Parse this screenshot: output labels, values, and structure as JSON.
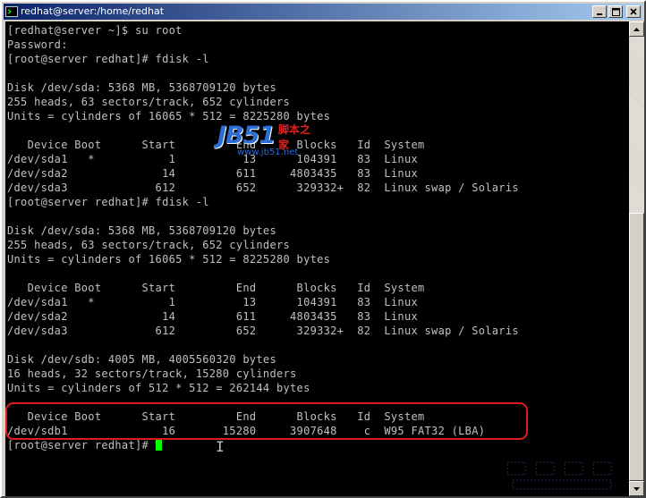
{
  "window": {
    "title": "redhat@server:/home/redhat",
    "controls": {
      "minimize": "_",
      "maximize": "□",
      "close": "×"
    }
  },
  "terminal": {
    "lines": [
      "[redhat@server ~]$ su root",
      "Password:",
      "[root@server redhat]# fdisk -l",
      "",
      "Disk /dev/sda: 5368 MB, 5368709120 bytes",
      "255 heads, 63 sectors/track, 652 cylinders",
      "Units = cylinders of 16065 * 512 = 8225280 bytes",
      "",
      "   Device Boot      Start         End      Blocks   Id  System",
      "/dev/sda1   *           1          13      104391   83  Linux",
      "/dev/sda2              14         611     4803435   83  Linux",
      "/dev/sda3             612         652      329332+  82  Linux swap / Solaris",
      "[root@server redhat]# fdisk -l",
      "",
      "Disk /dev/sda: 5368 MB, 5368709120 bytes",
      "255 heads, 63 sectors/track, 652 cylinders",
      "Units = cylinders of 16065 * 512 = 8225280 bytes",
      "",
      "   Device Boot      Start         End      Blocks   Id  System",
      "/dev/sda1   *           1          13      104391   83  Linux",
      "/dev/sda2              14         611     4803435   83  Linux",
      "/dev/sda3             612         652      329332+  82  Linux swap / Solaris",
      "",
      "Disk /dev/sdb: 4005 MB, 4005560320 bytes",
      "16 heads, 32 sectors/track, 15280 cylinders",
      "Units = cylinders of 512 * 512 = 262144 bytes",
      "",
      "   Device Boot      Start         End      Blocks   Id  System",
      "/dev/sdb1              16       15280     3907648    c  W95 FAT32 (LBA)"
    ],
    "prompt": "[root@server redhat]# ",
    "cursor_color": "#00ff00",
    "text_color": "#c0c0c0",
    "background": "#000000"
  },
  "annotation": {
    "color": "#e01b1b"
  },
  "watermark": {
    "logo_text": "JB51",
    "logo_cn": "脚本之家",
    "url": "www.jb51.net"
  },
  "colors": {
    "title_gradient_start": "#0a246a",
    "title_gradient_end": "#a6caf0",
    "chrome": "#d4d0c8"
  }
}
